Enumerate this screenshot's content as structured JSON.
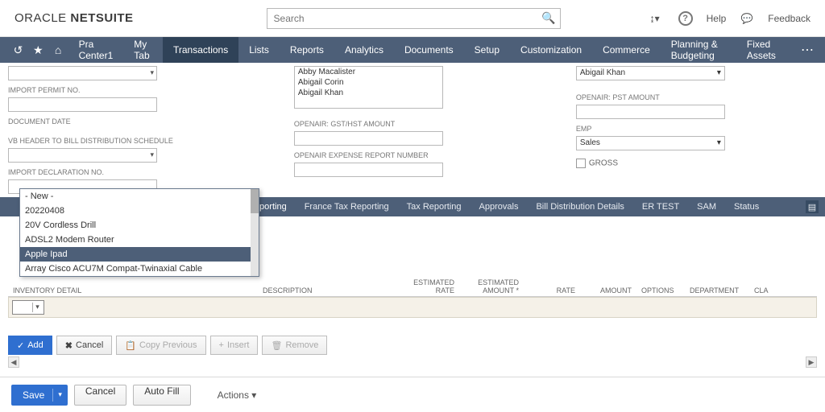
{
  "header": {
    "brand_left": "ORACLE",
    "brand_right": "NETSUITE",
    "search_placeholder": "Search",
    "help": "Help",
    "feedback": "Feedback"
  },
  "nav": {
    "items": [
      "Pra Center1",
      "My Tab",
      "Transactions",
      "Lists",
      "Reports",
      "Analytics",
      "Documents",
      "Setup",
      "Customization",
      "Commerce",
      "Planning & Budgeting",
      "Fixed Assets"
    ],
    "active_index": 2
  },
  "form": {
    "col1": {
      "import_permit_no": "IMPORT PERMIT NO.",
      "document_date": "DOCUMENT DATE",
      "vb_header": "VB HEADER TO BILL DISTRIBUTION SCHEDULE",
      "import_declaration_no": "IMPORT DECLARATION NO."
    },
    "col2": {
      "names": [
        "Abby Macalister",
        "Abigail Corin",
        "Abigail Khan"
      ],
      "gst_hst": "OPENAIR: GST/HST AMOUNT",
      "expense_report": "OPENAIR EXPENSE REPORT NUMBER"
    },
    "col3": {
      "top_value": "Abigail Khan",
      "pst_amount": "OPENAIR: PST AMOUNT",
      "emp": "EMP",
      "emp_value": "Sales",
      "gross": "GROSS"
    }
  },
  "tabstrip": {
    "items": [
      "Reporting",
      "France Tax Reporting",
      "Tax Reporting",
      "Approvals",
      "Bill Distribution Details",
      "ER TEST",
      "SAM",
      "Status"
    ]
  },
  "dropdown": {
    "items": [
      "- New -",
      "20220408",
      "20V Cordless Drill",
      "ADSL2 Modem Router",
      "Apple Ipad",
      "Array Cisco ACU7M Compat-Twinaxial Cable"
    ],
    "hover_index": 4
  },
  "grid": {
    "columns": [
      "INVENTORY DETAIL",
      "DESCRIPTION",
      "ESTIMATED RATE",
      "ESTIMATED AMOUNT *",
      "RATE",
      "AMOUNT",
      "OPTIONS",
      "DEPARTMENT",
      "CLA"
    ]
  },
  "grid_buttons": {
    "add": "Add",
    "cancel": "Cancel",
    "copy_previous": "Copy Previous",
    "insert": "Insert",
    "remove": "Remove"
  },
  "footer": {
    "save": "Save",
    "cancel": "Cancel",
    "autofill": "Auto Fill",
    "actions": "Actions"
  }
}
